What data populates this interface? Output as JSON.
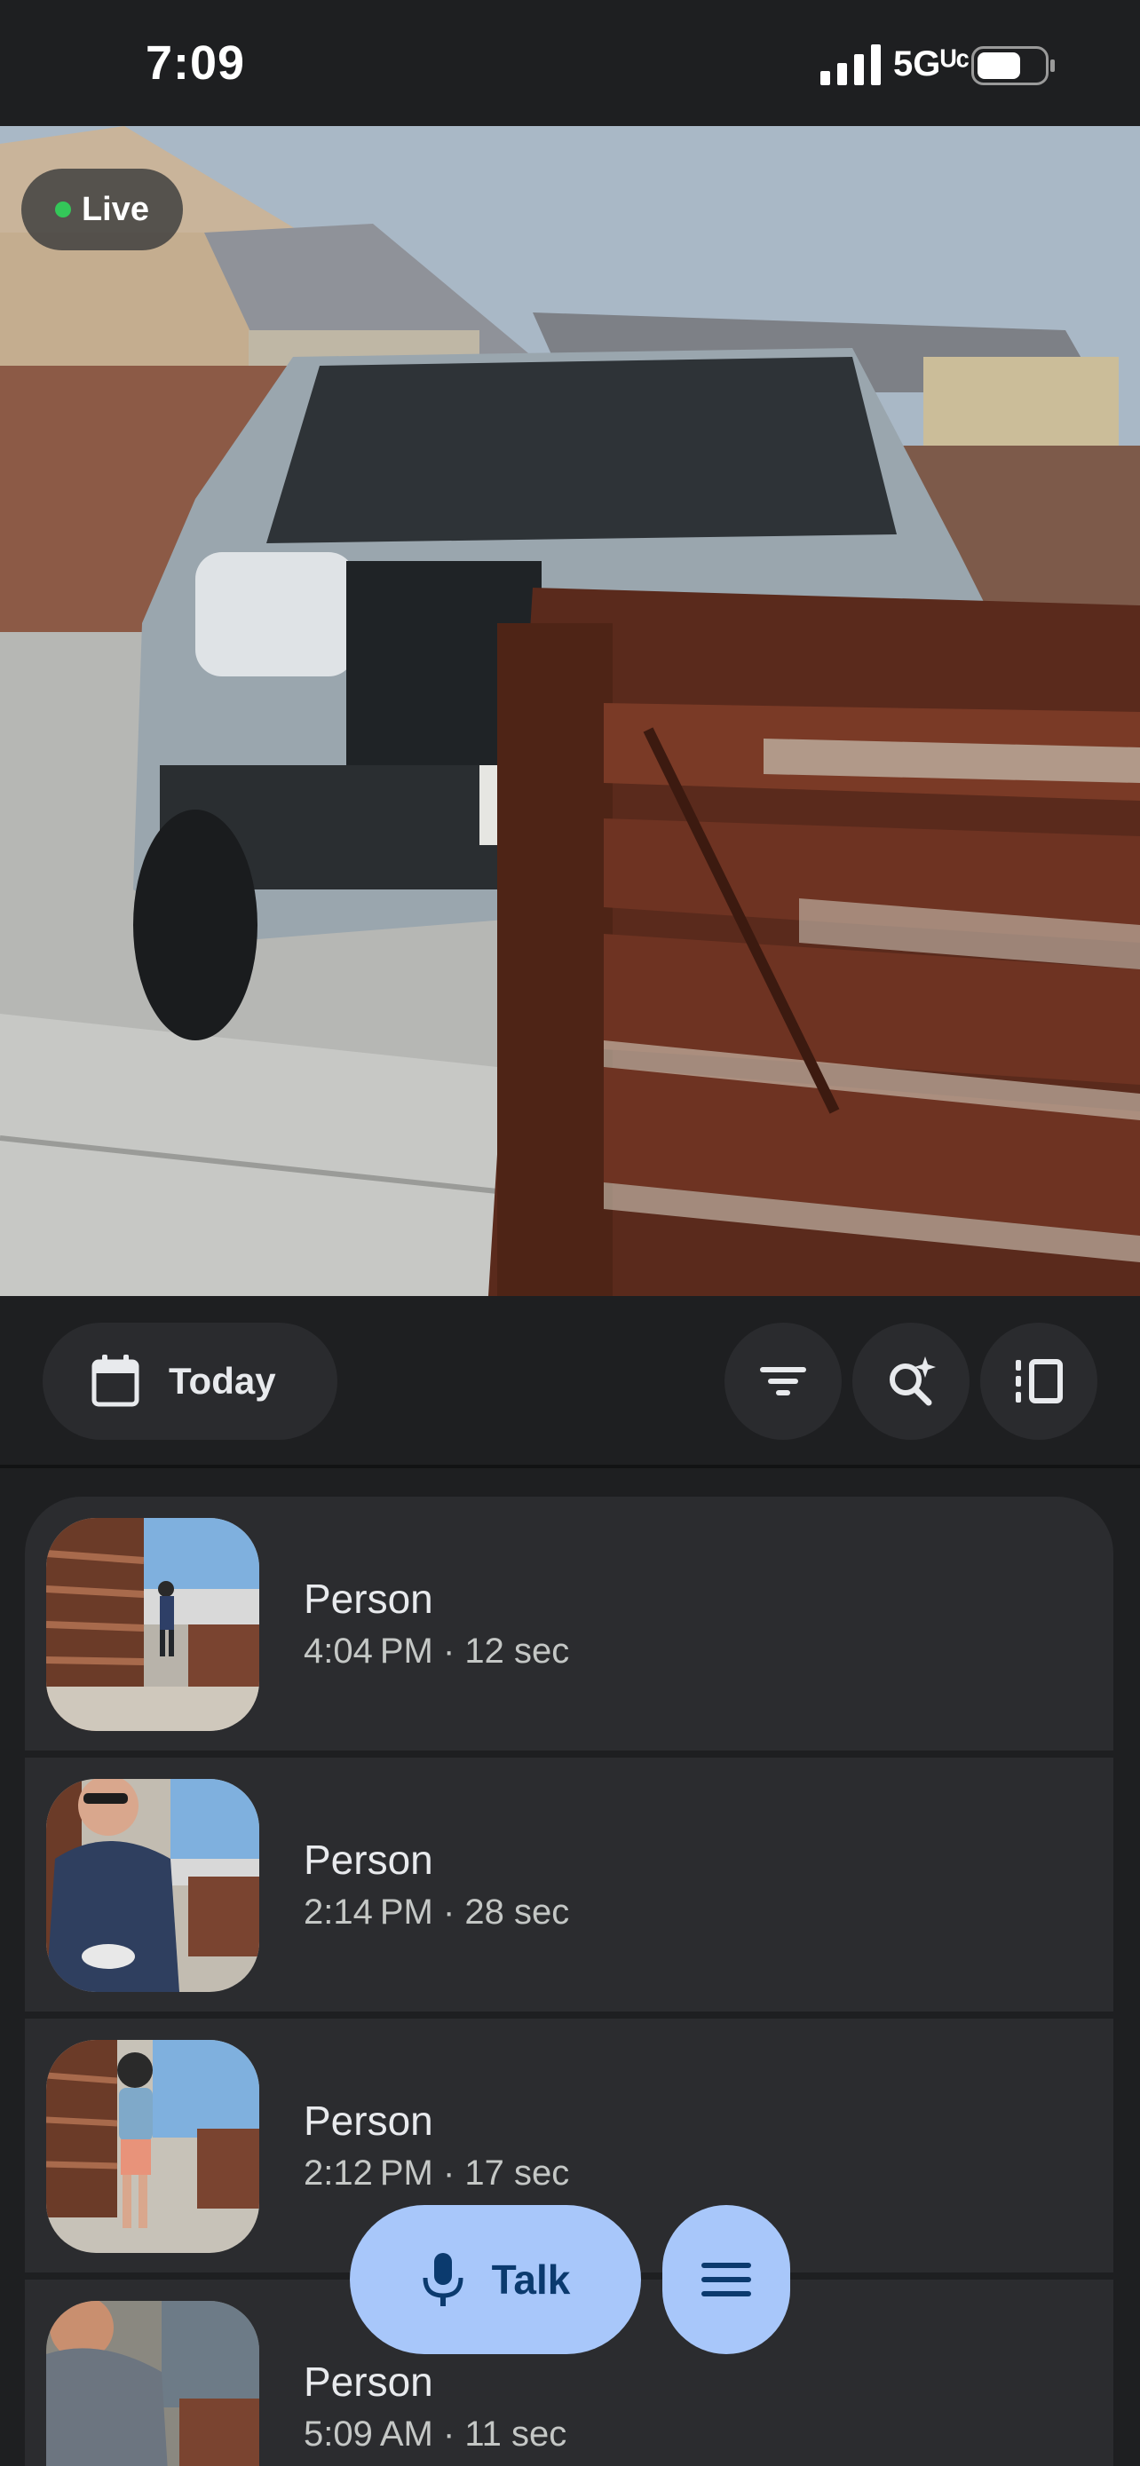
{
  "status_bar": {
    "time": "7:09",
    "network": "5Gᵁᶜ",
    "signal_icon": "cellular-signal-icon",
    "battery_icon": "battery-icon"
  },
  "camera": {
    "live_label": "Live",
    "live_color": "#34c759"
  },
  "toolbar": {
    "date_label": "Today",
    "date_icon": "calendar-icon",
    "filter_icon": "filter-icon",
    "search_icon": "ai-search-icon",
    "layout_icon": "timeline-layout-icon"
  },
  "events": [
    {
      "title": "Person",
      "meta": "4:04 PM · 12 sec"
    },
    {
      "title": "Person",
      "meta": "2:14 PM · 28 sec"
    },
    {
      "title": "Person",
      "meta": "2:12 PM · 17 sec"
    },
    {
      "title": "Person",
      "meta": "5:09 AM · 11 sec"
    }
  ],
  "controls": {
    "talk_label": "Talk",
    "talk_icon": "microphone-icon",
    "menu_icon": "hamburger-menu-icon",
    "accent": "#a8c7fa"
  }
}
